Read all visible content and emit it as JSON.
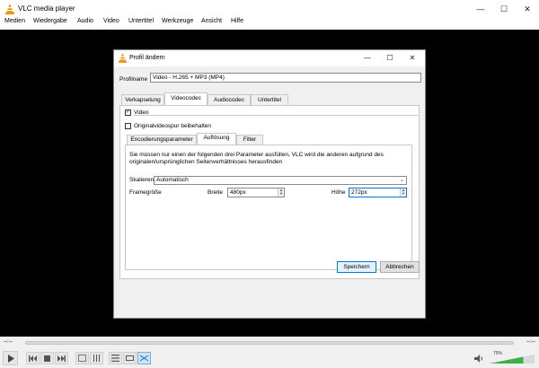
{
  "window": {
    "title": "VLC media player",
    "controls": {
      "minimize": "—",
      "maximize": "☐",
      "close": "✕"
    }
  },
  "menu": [
    "Medien",
    "Wiedergabe",
    "Audio",
    "Video",
    "Untertitel",
    "Werkzeuge",
    "Ansicht",
    "Hilfe"
  ],
  "player": {
    "time_elapsed": "--:--",
    "time_total": "--:--",
    "volume": "75%",
    "volume_level": 0.75,
    "icons": {
      "play": "play-icon",
      "prev": "previous-icon",
      "stop": "stop-icon",
      "next": "next-icon",
      "fullscreen": "fullscreen-icon",
      "extended": "extended-settings-icon",
      "playlist": "playlist-icon",
      "loop": "loop-icon",
      "shuffle": "shuffle-icon",
      "speaker": "speaker-icon"
    }
  },
  "dialog": {
    "title": "Profil ändern",
    "profile_name_label": "Profilname",
    "profile_name_value": "Video - H.265 + MP3 (MP4)",
    "tabs": [
      "Verkapselung",
      "Videocodec",
      "Audiocodec",
      "Untertitel"
    ],
    "active_tab": "Videocodec",
    "video_checkbox": {
      "label": "Video",
      "checked": true
    },
    "keep_original_checkbox": {
      "label": "Originalvideospur beibehalten",
      "checked": false
    },
    "subtabs": [
      "Encodierungsparameter",
      "Auflösung",
      "Filter"
    ],
    "active_subtab": "Auflösung",
    "info_text": "Sie müssen nur einen der folgenden drei Parameter ausfüllen, VLC wird die anderen aufgrund des originalen/ursprünglichen Seitenverhältnisses herausfinden",
    "scale_label": "Skalieren",
    "scale_value": "Automatisch",
    "framesize_label": "Framegröße",
    "width_label": "Breite",
    "width_value": "480px",
    "height_label": "Höhe",
    "height_value": "272px",
    "save_button": "Speichern",
    "cancel_button": "Abbrechen"
  },
  "colors": {
    "accent": "#0078d7",
    "vlc_orange": "#f39200",
    "dialog_bg": "#f0f0f0",
    "video_bg": "#000000"
  }
}
